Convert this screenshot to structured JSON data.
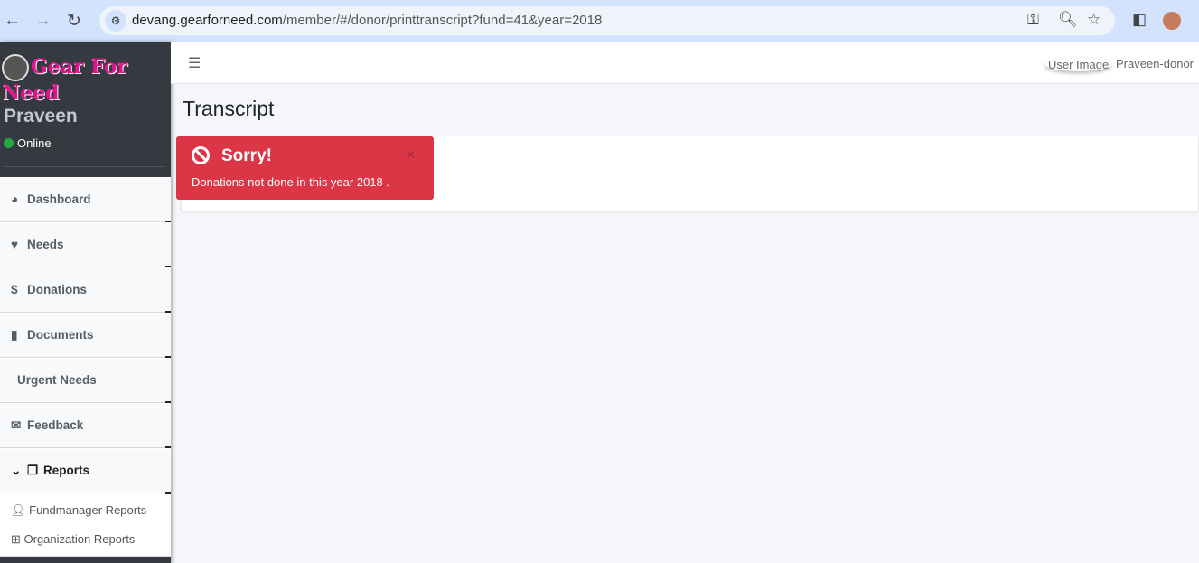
{
  "browser": {
    "url_host": "devang.gearforneed.com",
    "url_path": "/member/#/donor/printtranscript?fund=41&year=2018"
  },
  "sidebar": {
    "logo": "Gear For Need",
    "user": "Praveen",
    "status": "Online",
    "items": [
      {
        "label": "Dashboard",
        "icon": "chart-pie-icon"
      },
      {
        "label": "Needs",
        "icon": "hand-holding-heart-icon"
      },
      {
        "label": "Donations",
        "icon": "money-icon"
      },
      {
        "label": "Documents",
        "icon": "file-icon"
      },
      {
        "label": "Urgent Needs",
        "icon": ""
      },
      {
        "label": "Feedback",
        "icon": "envelope-icon"
      },
      {
        "label": "Reports",
        "icon": "copy-icon"
      }
    ],
    "subitems": [
      {
        "label": "Fundmanager Reports",
        "icon": "user-icon"
      },
      {
        "label": "Organization Reports",
        "icon": "sitemap-icon"
      }
    ]
  },
  "header": {
    "user_image_alt": "User Image",
    "user_name": "Praveen-donor"
  },
  "page": {
    "title": "Transcript"
  },
  "alert": {
    "title": "Sorry!",
    "message": "Donations not done in this year 2018 .",
    "close": "×",
    "color": "#dc3545"
  }
}
